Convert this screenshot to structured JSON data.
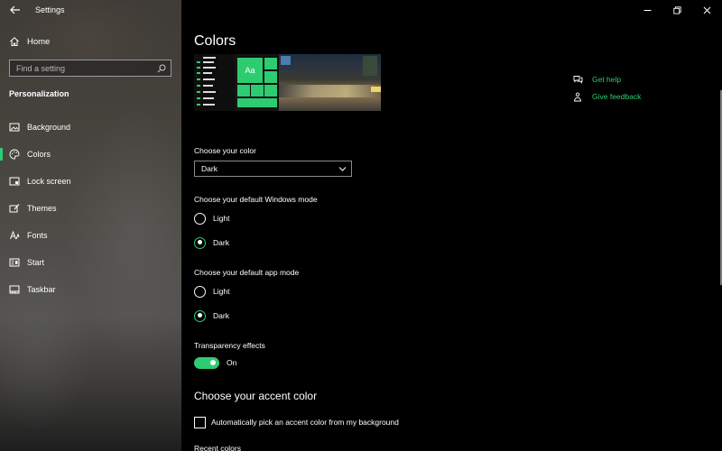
{
  "window": {
    "title": "Settings",
    "controls": [
      "minimize",
      "maximize",
      "close"
    ]
  },
  "sidebar": {
    "home_label": "Home",
    "search_placeholder": "Find a setting",
    "section_heading": "Personalization",
    "items": [
      {
        "label": "Background",
        "icon": "picture-icon",
        "active": false
      },
      {
        "label": "Colors",
        "icon": "palette-icon",
        "active": true
      },
      {
        "label": "Lock screen",
        "icon": "lock-screen-icon",
        "active": false
      },
      {
        "label": "Themes",
        "icon": "brush-icon",
        "active": false
      },
      {
        "label": "Fonts",
        "icon": "font-icon",
        "active": false
      },
      {
        "label": "Start",
        "icon": "start-icon",
        "active": false
      },
      {
        "label": "Taskbar",
        "icon": "taskbar-icon",
        "active": false
      }
    ]
  },
  "main": {
    "title": "Colors",
    "preview": {
      "tile_text": "Aa"
    },
    "choose_color": {
      "label": "Choose your color",
      "value": "Dark"
    },
    "windows_mode": {
      "label": "Choose your default Windows mode",
      "options": [
        "Light",
        "Dark"
      ],
      "selected": "Dark"
    },
    "app_mode": {
      "label": "Choose your default app mode",
      "options": [
        "Light",
        "Dark"
      ],
      "selected": "Dark"
    },
    "transparency": {
      "label": "Transparency effects",
      "state": "On",
      "enabled": true
    },
    "accent": {
      "heading": "Choose your accent color",
      "auto_pick_label": "Automatically pick an accent color from my background",
      "auto_pick_checked": false,
      "recent_label": "Recent colors"
    }
  },
  "help": {
    "get_help": "Get help",
    "give_feedback": "Give feedback"
  },
  "colors": {
    "accent": "#2ecc71",
    "background": "#000000",
    "text": "#ffffff"
  }
}
